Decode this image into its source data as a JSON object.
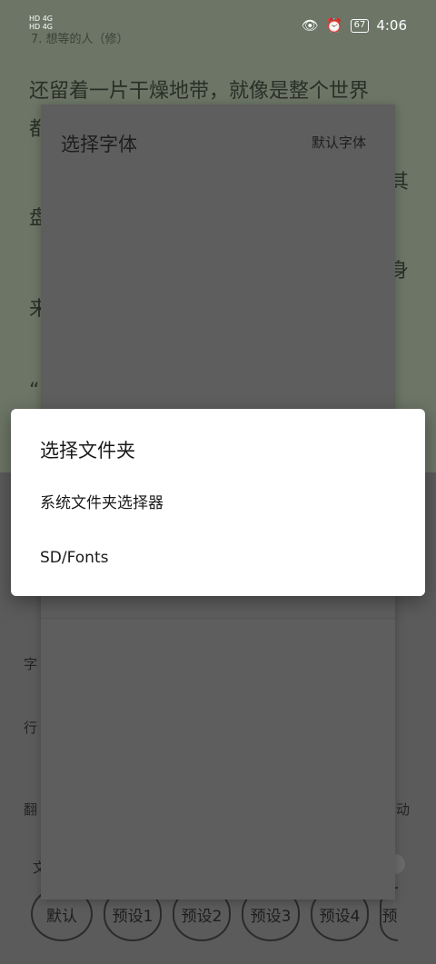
{
  "status_bar": {
    "left_top": "HD 4G",
    "left_bottom": "HD 4G",
    "battery": "67",
    "time": "4:06"
  },
  "reader": {
    "chapter_title": "7. 想等的人（修）",
    "lines": [
      "还留着一片干燥地带，就像是整个世界",
      "都",
      "其",
      "盘",
      "身",
      "来",
      "“"
    ]
  },
  "font_dialog": {
    "title": "选择字体",
    "default_button": "默认字体"
  },
  "settings": {
    "labels": [
      "字",
      "行",
      "翻",
      "动",
      "文"
    ],
    "presets": [
      "默认",
      "预设1",
      "预设2",
      "预设3",
      "预设4",
      "预"
    ]
  },
  "folder_dialog": {
    "title": "选择文件夹",
    "options": [
      "系统文件夹选择器",
      "SD/Fonts"
    ]
  },
  "colors": {
    "dialog_bg": "#ffffff",
    "overlay": "#5e5e5e"
  }
}
